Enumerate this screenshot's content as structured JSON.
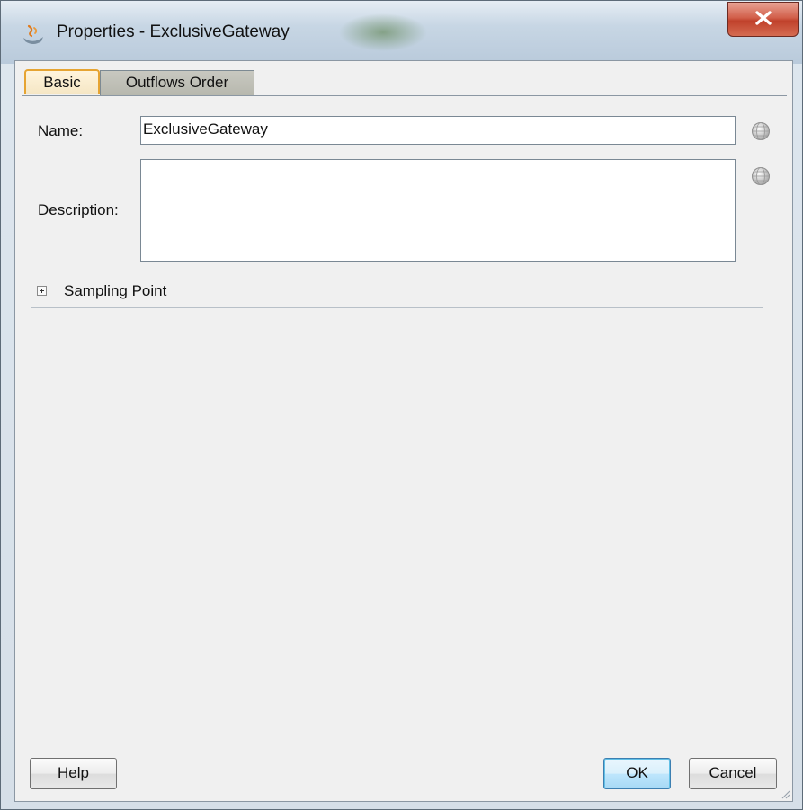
{
  "window": {
    "title": "Properties - ExclusiveGateway",
    "close_symbol": "x"
  },
  "tabs": [
    {
      "label": "Basic",
      "selected": true
    },
    {
      "label": "Outflows Order",
      "selected": false
    }
  ],
  "form": {
    "name_label": "Name:",
    "name_value": "ExclusiveGateway",
    "description_label": "Description:",
    "description_value": "",
    "name_action_icon": "globe-icon",
    "description_action_icon": "globe-icon"
  },
  "sections": {
    "sampling_point_label": "Sampling Point",
    "sampling_point_expanded": false
  },
  "buttons": {
    "help": "Help",
    "ok": "OK",
    "cancel": "Cancel"
  },
  "colors": {
    "selected_tab_border": "#e6a432",
    "ok_button_border": "#3c7fb1",
    "close_button": "#c0412b"
  }
}
